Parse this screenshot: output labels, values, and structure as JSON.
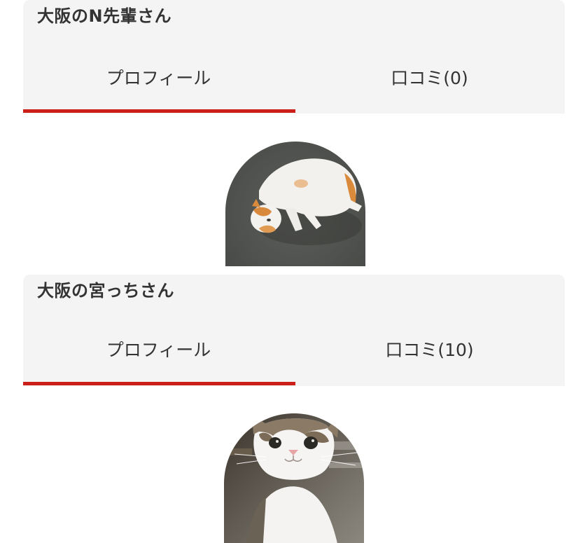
{
  "profiles": [
    {
      "name": "大阪のN先輩さん",
      "tabs": [
        {
          "label": "プロフィール",
          "active": true
        },
        {
          "label": "口コミ(0)",
          "active": false
        }
      ],
      "avatar_subject": "white-and-orange cat lying on asphalt"
    },
    {
      "name": "大阪の宮っちさん",
      "tabs": [
        {
          "label": "プロフィール",
          "active": true
        },
        {
          "label": "口コミ(10)",
          "active": false
        }
      ],
      "avatar_subject": "tabby-and-white cat looking at camera"
    }
  ],
  "colors": {
    "card_background": "#f4f4f4",
    "active_tab_indicator": "#cc1f1a",
    "text": "#333333"
  }
}
